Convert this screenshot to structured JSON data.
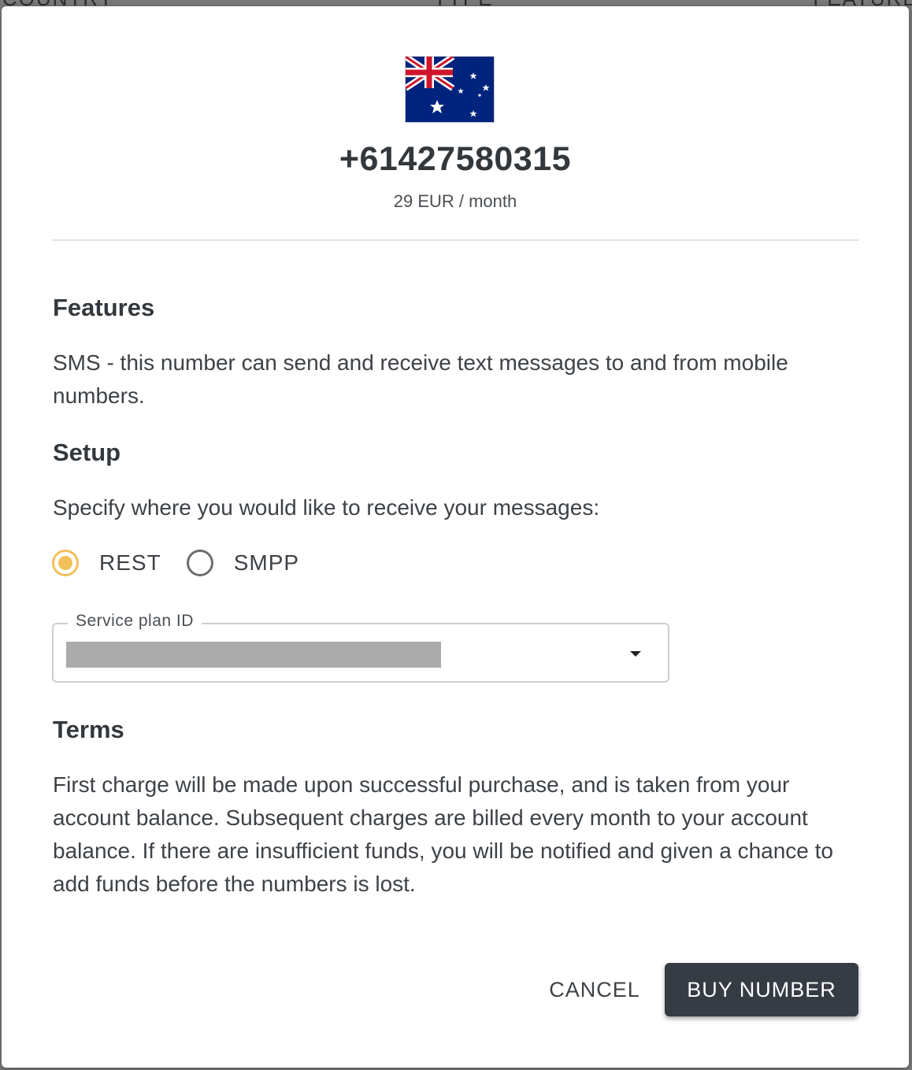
{
  "backdrop": {
    "columns": [
      "COUNTRY",
      "TYPE",
      "FEATURES"
    ]
  },
  "dialog": {
    "flag_icon": "australia-flag-icon",
    "phone_number": "+61427580315",
    "price": "29 EUR / month",
    "features": {
      "heading": "Features",
      "text": "SMS - this number can send and receive text messages to and from mobile numbers."
    },
    "setup": {
      "heading": "Setup",
      "prompt": "Specify where you would like to receive your messages:",
      "options": [
        {
          "label": "REST",
          "selected": true
        },
        {
          "label": "SMPP",
          "selected": false
        }
      ],
      "service_plan": {
        "label": "Service plan ID",
        "value": ""
      }
    },
    "terms": {
      "heading": "Terms",
      "text": "First charge will be made upon successful purchase, and is taken from your account balance. Subsequent charges are billed every month to your account balance. If there are insufficient funds, you will be notified and given a chance to add funds before the numbers is lost."
    },
    "actions": {
      "cancel_label": "CANCEL",
      "buy_label": "BUY NUMBER"
    }
  },
  "colors": {
    "accent": "#f2c05b",
    "primary_button": "#353c44",
    "text": "#33383d"
  }
}
